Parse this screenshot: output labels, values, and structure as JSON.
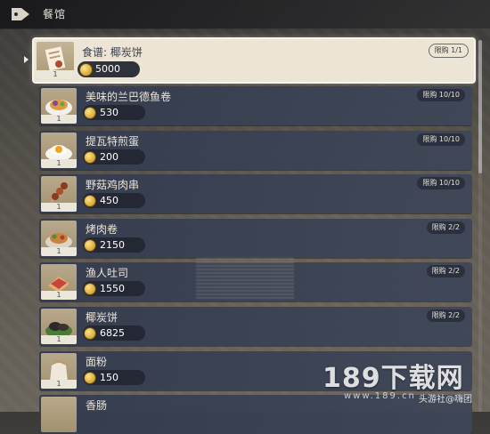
{
  "header": {
    "title": "餐馆",
    "icon": "price-tag-icon"
  },
  "items": [
    {
      "name": "食谱: 椰炭饼",
      "price": "5000",
      "limit": "限购 1/1",
      "qty": "1",
      "icon": "recipe-scroll-icon",
      "selected": true
    },
    {
      "name": "美味的兰巴德鱼卷",
      "price": "530",
      "limit": "限购 10/10",
      "qty": "1",
      "icon": "fish-roll-dish-icon"
    },
    {
      "name": "提瓦特煎蛋",
      "price": "200",
      "limit": "限购 10/10",
      "qty": "1",
      "icon": "fried-egg-dish-icon"
    },
    {
      "name": "野菇鸡肉串",
      "price": "450",
      "limit": "限购 10/10",
      "qty": "1",
      "icon": "skewer-dish-icon"
    },
    {
      "name": "烤肉卷",
      "price": "2150",
      "limit": "限购 2/2",
      "qty": "1",
      "icon": "meat-roll-dish-icon"
    },
    {
      "name": "渔人吐司",
      "price": "1550",
      "limit": "限购 2/2",
      "qty": "1",
      "icon": "toast-dish-icon"
    },
    {
      "name": "椰炭饼",
      "price": "6825",
      "limit": "限购 2/2",
      "qty": "1",
      "icon": "charcoal-cake-dish-icon"
    },
    {
      "name": "面粉",
      "price": "150",
      "limit": "",
      "qty": "1",
      "icon": "flour-sack-icon"
    },
    {
      "name": "香肠",
      "price": "",
      "limit": "",
      "qty": "",
      "icon": "sausage-icon"
    }
  ],
  "watermark": {
    "text": "189下载网",
    "sub": "www.189.cn",
    "sub2": "头游社@嗨团"
  },
  "colors": {
    "selected_bg": "#ece5d6",
    "row_bg": "#343c4e",
    "coin": "#d8a434"
  }
}
